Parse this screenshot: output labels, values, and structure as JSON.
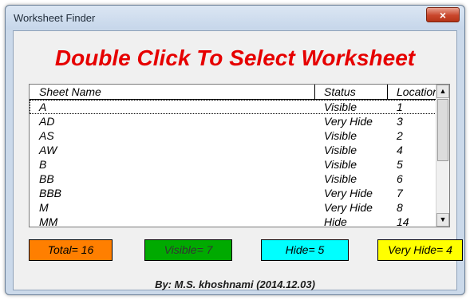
{
  "window": {
    "title": "Worksheet Finder",
    "close_glyph": "×"
  },
  "heading": "Double Click To Select Worksheet",
  "list": {
    "headers": [
      "Sheet Name",
      "Status",
      "Location"
    ],
    "rows": [
      {
        "name": "A",
        "status": "Visible",
        "location": "1"
      },
      {
        "name": "AD",
        "status": "Very Hide",
        "location": "3"
      },
      {
        "name": "AS",
        "status": "Visible",
        "location": "2"
      },
      {
        "name": "AW",
        "status": "Visible",
        "location": "4"
      },
      {
        "name": "B",
        "status": "Visible",
        "location": "5"
      },
      {
        "name": "BB",
        "status": "Visible",
        "location": "6"
      },
      {
        "name": "BBB",
        "status": "Very Hide",
        "location": "7"
      },
      {
        "name": "M",
        "status": "Very Hide",
        "location": "8"
      },
      {
        "name": "MM",
        "status": "Hide",
        "location": "14"
      }
    ],
    "selected_index": 0,
    "scroll_up_glyph": "▲",
    "scroll_down_glyph": "▼"
  },
  "stats": {
    "total": "Total= 16",
    "visible": "Visible= 7",
    "hide": "Hide= 5",
    "very_hide": "Very Hide= 4"
  },
  "byline": "By: M.S. khoshnami (2014.12.03)",
  "colors": {
    "heading": "#e60000",
    "total": "#ff7f00",
    "visible": "#00aa00",
    "hide": "#00ffff",
    "very_hide": "#ffff00"
  }
}
